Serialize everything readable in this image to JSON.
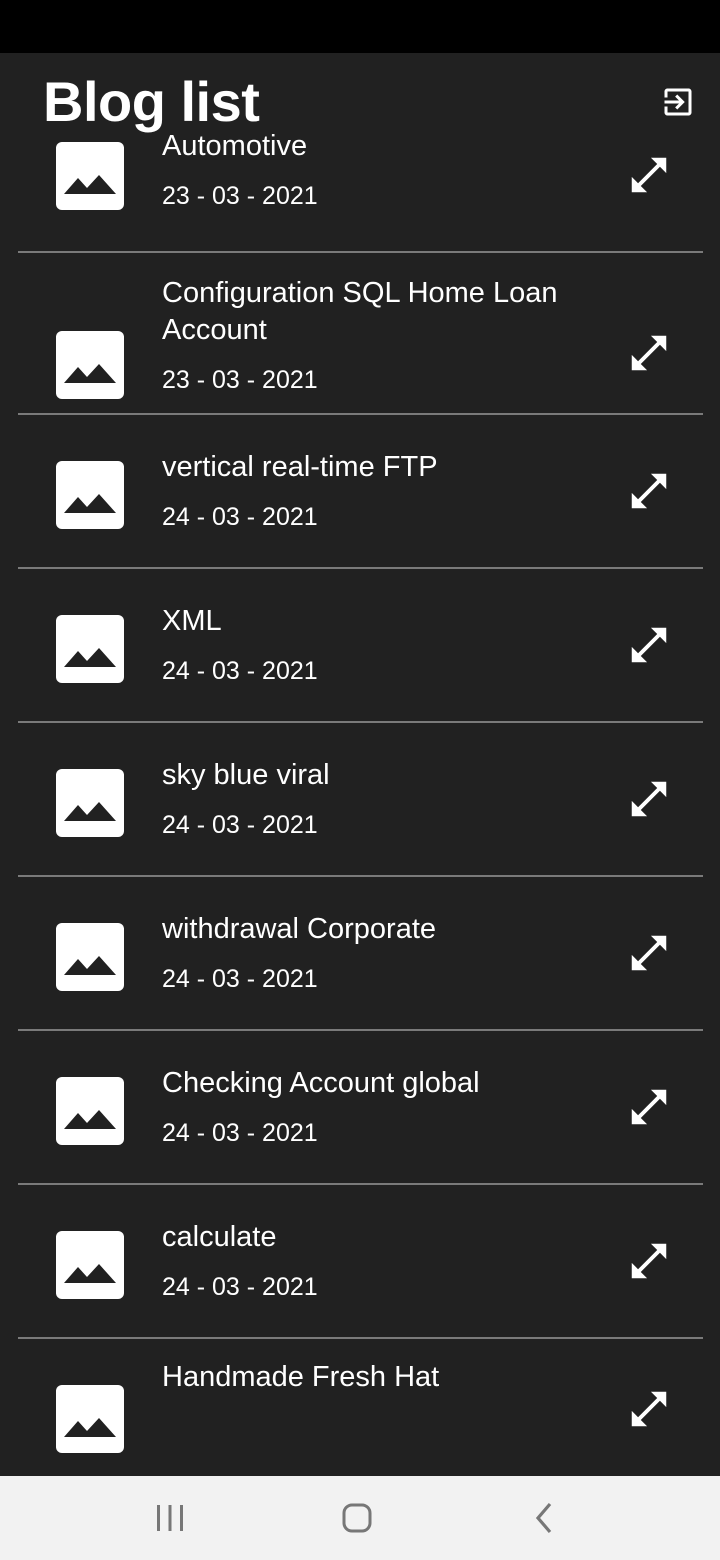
{
  "header": {
    "title": "Blog list",
    "logout_icon": "logout-icon"
  },
  "posts": [
    {
      "title": "Automotive",
      "date": "23 - 03 - 2021"
    },
    {
      "title": "Configuration SQL Home Loan Account",
      "date": "23 - 03 - 2021"
    },
    {
      "title": "vertical real-time FTP",
      "date": "24 - 03 - 2021"
    },
    {
      "title": "XML",
      "date": "24 - 03 - 2021"
    },
    {
      "title": "sky blue viral",
      "date": "24 - 03 - 2021"
    },
    {
      "title": "withdrawal Corporate",
      "date": "24 - 03 - 2021"
    },
    {
      "title": "Checking Account global",
      "date": "24 - 03 - 2021"
    },
    {
      "title": "calculate",
      "date": "24 - 03 - 2021"
    },
    {
      "title": "Handmade Fresh Hat",
      "date": ""
    }
  ],
  "icons": {
    "thumbnail": "image-placeholder-icon",
    "expand": "expand-arrows-icon"
  },
  "navigation": {
    "recents": "recent-apps-icon",
    "home": "home-icon",
    "back": "back-icon"
  },
  "colors": {
    "background": "#212121",
    "divider": "#7a7a7a",
    "text": "#ffffff",
    "nav_bar": "#f2f2f2"
  }
}
